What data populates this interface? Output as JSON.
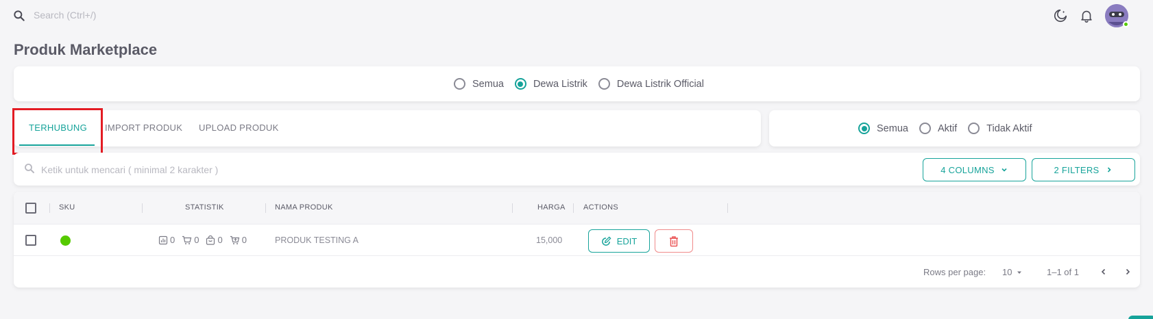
{
  "topbar": {
    "search_placeholder": "Search (Ctrl+/)"
  },
  "page": {
    "title": "Produk Marketplace"
  },
  "store_filter": {
    "options": [
      "Semua",
      "Dewa Listrik",
      "Dewa Listrik Official"
    ],
    "selected": "Dewa Listrik"
  },
  "tabs": [
    {
      "label": "TERHUBUNG",
      "active": true
    },
    {
      "label": "IMPORT PRODUK",
      "active": false
    },
    {
      "label": "UPLOAD PRODUK",
      "active": false
    }
  ],
  "status_filter": {
    "options": [
      "Semua",
      "Aktif",
      "Tidak Aktif"
    ],
    "selected": "Semua"
  },
  "search": {
    "placeholder": "Ketik untuk mencari ( minimal 2 karakter )"
  },
  "toolbar": {
    "columns_label": "4 COLUMNS",
    "filters_label": "2 FILTERS"
  },
  "table": {
    "headers": {
      "sku": "SKU",
      "statistik": "STATISTIK",
      "nama_produk": "NAMA PRODUK",
      "harga": "HARGA",
      "actions": "ACTIONS"
    },
    "rows": [
      {
        "status_color": "#56ca00",
        "stats": [
          "0",
          "0",
          "0",
          "0"
        ],
        "nama_produk": "PRODUK TESTING A",
        "harga": "15,000",
        "edit_label": "EDIT"
      }
    ]
  },
  "pagination": {
    "rows_per_page_label": "Rows per page:",
    "rows_per_page": "10",
    "range": "1–1 of 1"
  },
  "colors": {
    "accent": "#16a39a",
    "danger": "#ea5455",
    "success": "#56ca00",
    "highlight": "#e31b23"
  }
}
